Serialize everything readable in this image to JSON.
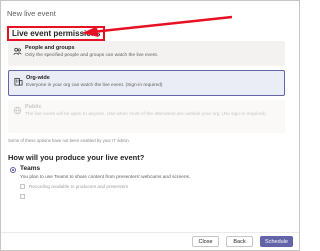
{
  "window": {
    "title": "New live event"
  },
  "permissions": {
    "heading": "Live event permissions",
    "options": [
      {
        "title": "People and groups",
        "desc": "Only the specified people and groups can watch the live event."
      },
      {
        "title": "Org-wide",
        "desc": "Everyone in your org can watch the live event. (Sign-in required)"
      },
      {
        "title": "Public",
        "desc": "The live event will be open to anyone. Use when most of the attendees are outside your org. (No sign-in required)"
      }
    ],
    "note": "Some of these options have not been enabled by your IT admin."
  },
  "produce": {
    "question": "How will you produce your live event?",
    "teams_label": "Teams",
    "teams_desc": "You plan to use Teams to share content from presenters' webcams and screens.",
    "checkbox1_label": "Recording available to producers and presenters",
    "checkbox2_label": ""
  },
  "footer": {
    "close_label": "Close",
    "back_label": "Back",
    "schedule_label": "Schedule"
  },
  "colors": {
    "accent": "#6264a7",
    "annotation_red": "#e81123"
  }
}
